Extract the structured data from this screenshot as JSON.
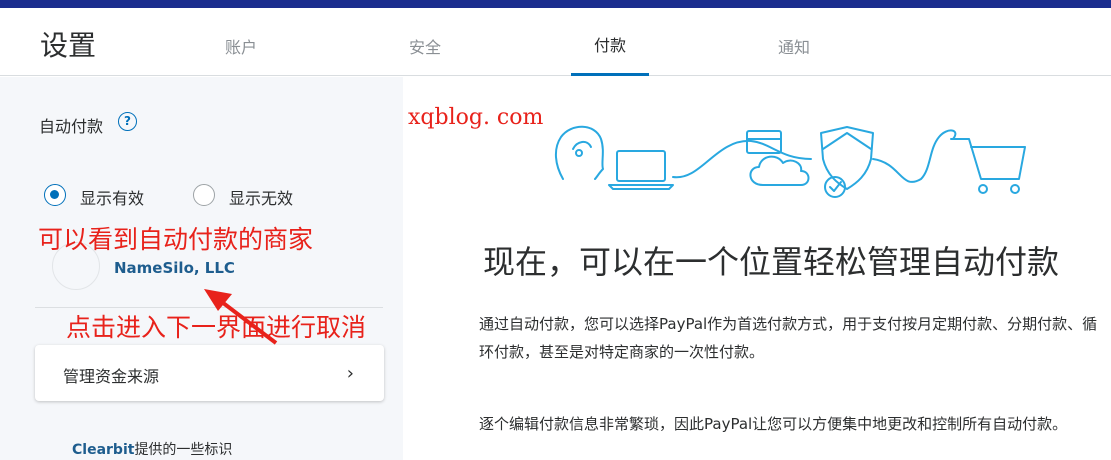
{
  "header": {
    "title": "设置",
    "tabs": [
      {
        "label": "账户"
      },
      {
        "label": "安全"
      },
      {
        "label": "付款"
      },
      {
        "label": "通知"
      }
    ],
    "active_tab": "付款"
  },
  "sidebar": {
    "auto_pay_label": "自动付款",
    "help_icon": "question-circle-icon",
    "filter": {
      "active_label": "显示有效",
      "inactive_label": "显示无效",
      "selected": "显示有效"
    },
    "merchant": {
      "name": "NameSilo, LLC"
    },
    "manage_label": "管理资金来源",
    "clearbit_brand": "Clearbit",
    "clearbit_text": "提供的一些标识"
  },
  "annotations": {
    "note1": "可以看到自动付款的商家",
    "note2": "点击进入下一界面进行取消",
    "watermark": "xqblog. com"
  },
  "main": {
    "headline": "现在，可以在一个位置轻松管理自动付款",
    "para1": "通过自动付款，您可以选择PayPal作为首选付款方式，用于支付按月定期付款、分期付款、循环付款，甚至是对特定商家的一次性付款。",
    "para2": "逐个编辑付款信息非常繁琐，因此PayPal让您可以方便集中地更改和控制所有自动付款。"
  },
  "colors": {
    "brand_blue": "#0070ba",
    "top_bar": "#1b2d8e",
    "annotation_red": "#e8221b"
  }
}
